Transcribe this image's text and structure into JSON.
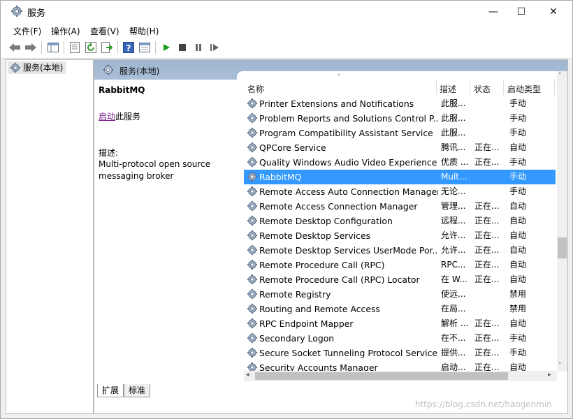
{
  "window": {
    "title": "服务",
    "controls": [
      "—",
      "☐",
      "✕"
    ]
  },
  "menu": [
    "文件(F)",
    "操作(A)",
    "查看(V)",
    "帮助(H)"
  ],
  "toolbar": {
    "icons": [
      "back-icon",
      "forward-icon",
      "show-hide-tree-icon",
      "properties-icon",
      "refresh-icon",
      "export-list-icon",
      "help-icon",
      "console-icon",
      "start-service-icon",
      "stop-service-icon",
      "pause-service-icon",
      "restart-service-icon"
    ],
    "colors": {
      "play": "#1aa11a",
      "stop": "#444444"
    }
  },
  "tree": {
    "root_label": "服务(本地)"
  },
  "pane_header": {
    "title": "服务(本地)"
  },
  "detail": {
    "service_name": "RabbitMQ",
    "start_link": "启动",
    "start_suffix": "此服务",
    "description_label": "描述:",
    "description": "Multi-protocol open source messaging broker"
  },
  "columns": {
    "name": "名称",
    "description": "描述",
    "status": "状态",
    "startup": "启动类型"
  },
  "services": [
    {
      "name": "Printer Extensions and Notifications",
      "description": "此服...",
      "status": "",
      "startup": "手动"
    },
    {
      "name": "Problem Reports and Solutions Control P...",
      "description": "此服...",
      "status": "",
      "startup": "手动"
    },
    {
      "name": "Program Compatibility Assistant Service",
      "description": "此服...",
      "status": "",
      "startup": "手动"
    },
    {
      "name": "QPCore Service",
      "description": "腾讯...",
      "status": "正在...",
      "startup": "自动"
    },
    {
      "name": "Quality Windows Audio Video Experience",
      "description": "优质 ...",
      "status": "正在...",
      "startup": "手动"
    },
    {
      "name": "RabbitMQ",
      "description": "Mult...",
      "status": "",
      "startup": "手动",
      "selected": true
    },
    {
      "name": "Remote Access Auto Connection Manager",
      "description": "无论...",
      "status": "",
      "startup": "手动"
    },
    {
      "name": "Remote Access Connection Manager",
      "description": "管理...",
      "status": "正在...",
      "startup": "自动"
    },
    {
      "name": "Remote Desktop Configuration",
      "description": "远程...",
      "status": "正在...",
      "startup": "自动"
    },
    {
      "name": "Remote Desktop Services",
      "description": "允许...",
      "status": "正在...",
      "startup": "自动"
    },
    {
      "name": "Remote Desktop Services UserMode Por...",
      "description": "允许...",
      "status": "正在...",
      "startup": "自动"
    },
    {
      "name": "Remote Procedure Call (RPC)",
      "description": "RPC...",
      "status": "正在...",
      "startup": "自动"
    },
    {
      "name": "Remote Procedure Call (RPC) Locator",
      "description": "在 W...",
      "status": "正在...",
      "startup": "自动"
    },
    {
      "name": "Remote Registry",
      "description": "使远...",
      "status": "",
      "startup": "禁用"
    },
    {
      "name": "Routing and Remote Access",
      "description": "在局...",
      "status": "",
      "startup": "禁用"
    },
    {
      "name": "RPC Endpoint Mapper",
      "description": "解析 ...",
      "status": "正在...",
      "startup": "自动"
    },
    {
      "name": "Secondary Logon",
      "description": "在不...",
      "status": "正在...",
      "startup": "手动"
    },
    {
      "name": "Secure Socket Tunneling Protocol Service",
      "description": "提供...",
      "status": "正在...",
      "startup": "手动"
    },
    {
      "name": "Security Accounts Manager",
      "description": "启动...",
      "status": "正在...",
      "startup": "自动"
    }
  ],
  "tabs": [
    {
      "label": "扩展",
      "active": true
    },
    {
      "label": "标准",
      "active": false
    }
  ],
  "watermark": "https://blog.csdn.net/haogenmin"
}
